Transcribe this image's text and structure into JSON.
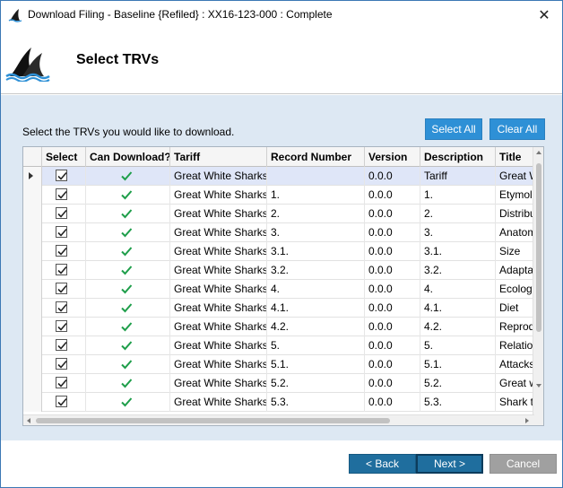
{
  "window": {
    "title": "Download Filing - Baseline {Refiled} : XX16-123-000 : Complete",
    "close_label": "✕"
  },
  "header": {
    "title": "Select TRVs"
  },
  "content": {
    "instruction": "Select the TRVs you would like to download.",
    "select_all_label": "Select All",
    "clear_all_label": "Clear All"
  },
  "grid": {
    "columns": [
      "Select",
      "Can Download?",
      "Tariff",
      "Record Number",
      "Version",
      "Description",
      "Title"
    ],
    "rows": [
      {
        "tariff": "Great White Sharks",
        "record": "",
        "version": "0.0.0",
        "description": "Tariff",
        "title": "Great White Sharks"
      },
      {
        "tariff": "Great White Sharks",
        "record": "1.",
        "version": "0.0.0",
        "description": "1.",
        "title": "Etymology"
      },
      {
        "tariff": "Great White Sharks",
        "record": "2.",
        "version": "0.0.0",
        "description": "2.",
        "title": "Distribution"
      },
      {
        "tariff": "Great White Sharks",
        "record": "3.",
        "version": "0.0.0",
        "description": "3.",
        "title": "Anatomy"
      },
      {
        "tariff": "Great White Sharks",
        "record": "3.1.",
        "version": "0.0.0",
        "description": "3.1.",
        "title": "Size"
      },
      {
        "tariff": "Great White Sharks",
        "record": "3.2.",
        "version": "0.0.0",
        "description": "3.2.",
        "title": "Adaptations"
      },
      {
        "tariff": "Great White Sharks",
        "record": "4.",
        "version": "0.0.0",
        "description": "4.",
        "title": "Ecology"
      },
      {
        "tariff": "Great White Sharks",
        "record": "4.1.",
        "version": "0.0.0",
        "description": "4.1.",
        "title": "Diet"
      },
      {
        "tariff": "Great White Sharks",
        "record": "4.2.",
        "version": "0.0.0",
        "description": "4.2.",
        "title": "Reproduction"
      },
      {
        "tariff": "Great White Sharks",
        "record": "5.",
        "version": "0.0.0",
        "description": "5.",
        "title": "Relationship"
      },
      {
        "tariff": "Great White Sharks",
        "record": "5.1.",
        "version": "0.0.0",
        "description": "5.1.",
        "title": "Attacks"
      },
      {
        "tariff": "Great White Sharks",
        "record": "5.2.",
        "version": "0.0.0",
        "description": "5.2.",
        "title": "Great white"
      },
      {
        "tariff": "Great White Sharks",
        "record": "5.3.",
        "version": "0.0.0",
        "description": "5.3.",
        "title": "Shark tourism"
      }
    ]
  },
  "footer": {
    "back_label": "< Back",
    "next_label": "Next >",
    "cancel_label": "Cancel"
  },
  "colors": {
    "accent": "#2e90d6",
    "nav_button": "#1f6e9e",
    "disabled": "#a0a0a0",
    "check_green": "#1e9e4a",
    "panel": "#dde8f3"
  }
}
